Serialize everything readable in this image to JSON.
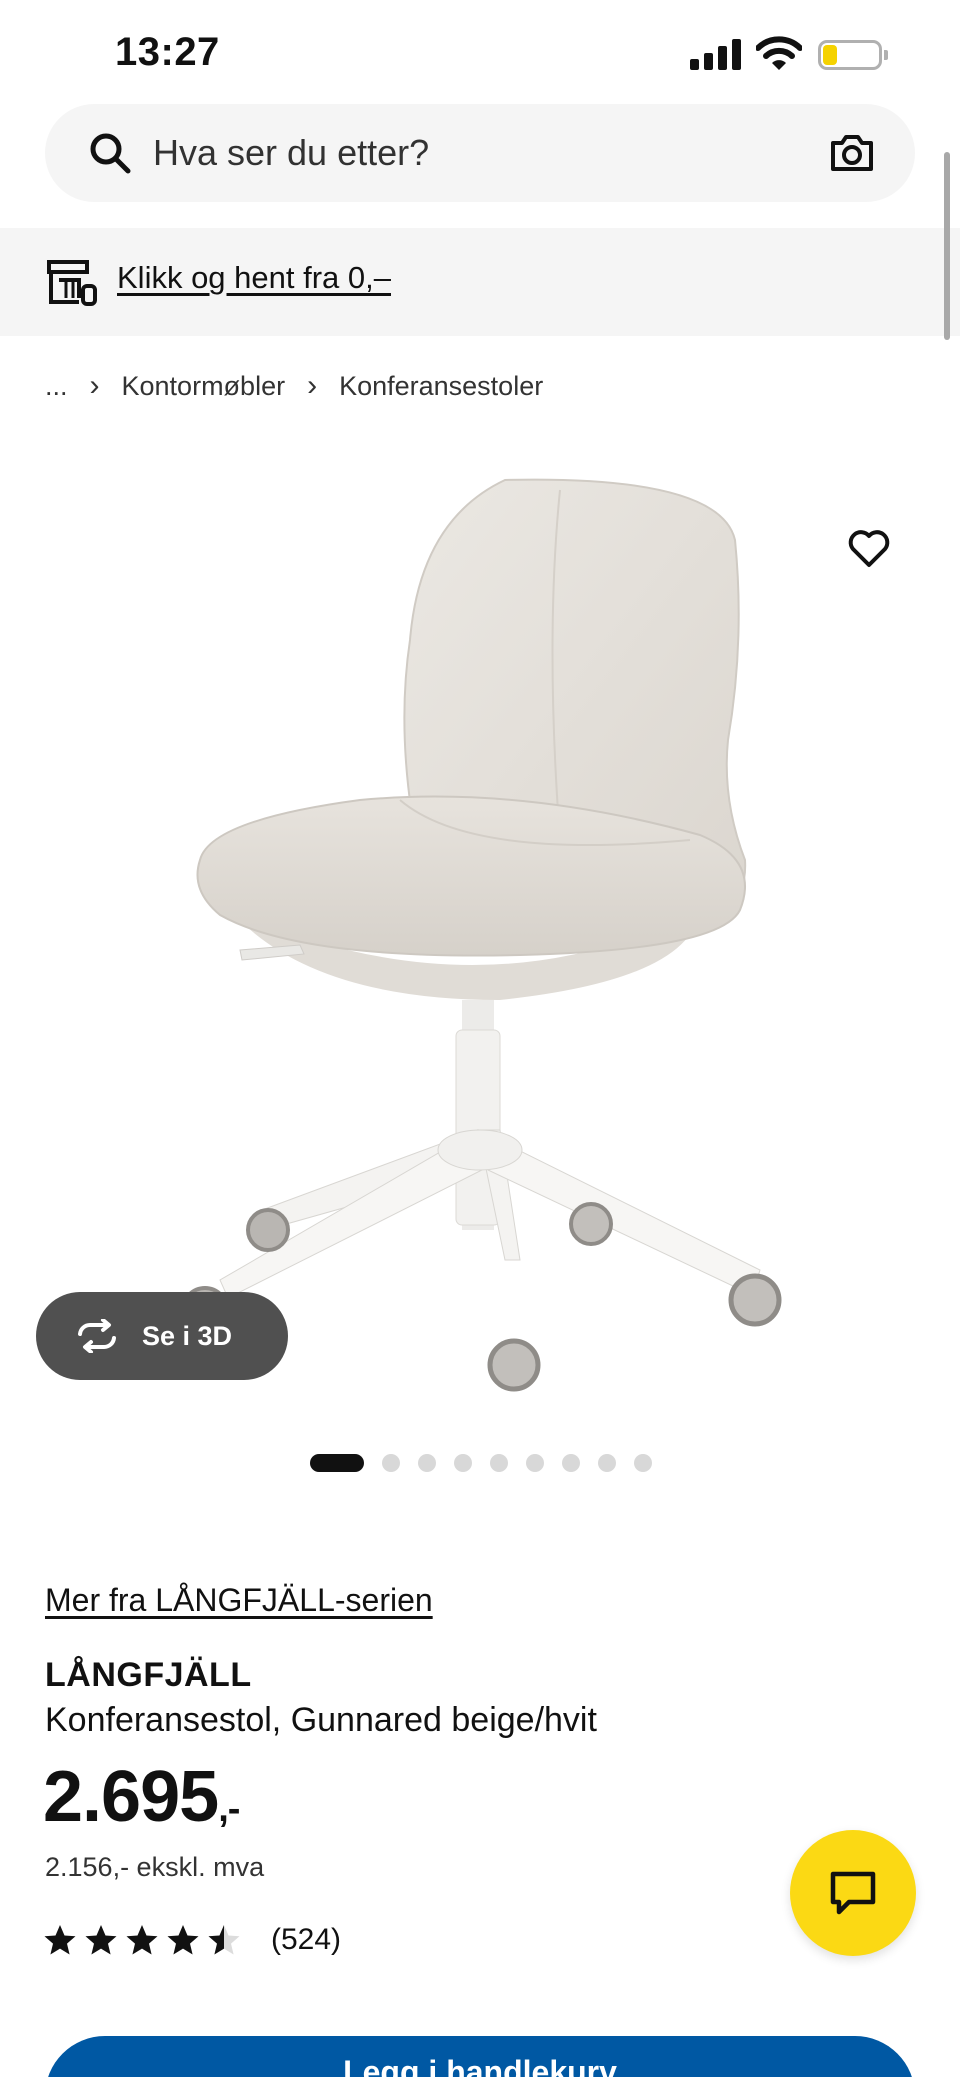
{
  "status_bar": {
    "time": "13:27"
  },
  "search": {
    "placeholder": "Hva ser du etter?"
  },
  "promo": {
    "label": "Klikk og hent fra 0,–"
  },
  "breadcrumb": {
    "ellipsis": "...",
    "items": [
      "Kontormøbler",
      "Konferansestoler"
    ]
  },
  "gallery": {
    "view_3d_label": "Se i 3D",
    "slide_count": 9,
    "active_slide": 1
  },
  "product": {
    "series_link": "Mer fra LÅNGFJÄLL-serien",
    "name": "LÅNGFJÄLL",
    "description": "Konferansestol, Gunnared beige/hvit",
    "price_main": "2.695",
    "price_suffix": ",-",
    "price_ex_vat": "2.156,- ekskl. mva",
    "rating": 4.5,
    "review_count": "(524)"
  },
  "cta": {
    "add_to_cart_label": "Legg i handlekurv"
  },
  "colors": {
    "brand_blue": "#0058a3",
    "brand_yellow": "#fbd914",
    "panel_gray": "#f5f5f5",
    "chair_fabric": "#e4e0da"
  },
  "icons": [
    "signal-icon",
    "wifi-icon",
    "battery-icon",
    "search-icon",
    "camera-icon",
    "store-icon",
    "chevron-right-icon",
    "heart-icon",
    "rotate-3d-icon",
    "star-icon",
    "chat-icon"
  ]
}
